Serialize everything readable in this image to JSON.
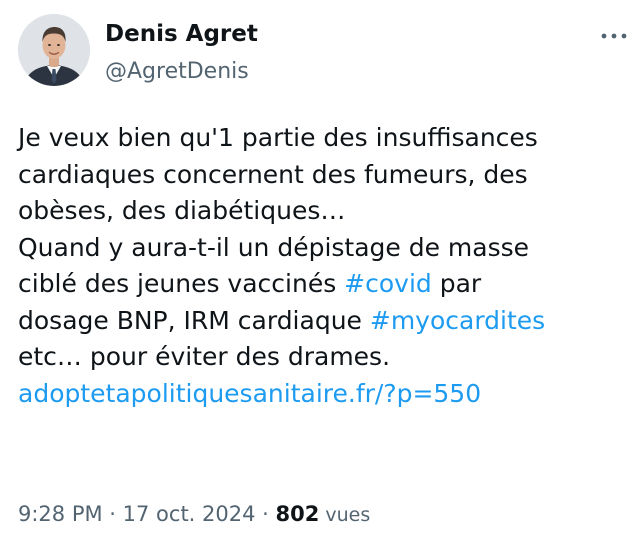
{
  "author": {
    "name": "Denis Agret",
    "handle": "@AgretDenis",
    "avatar_icon": "profile-photo-man-in-suit"
  },
  "menu": {
    "icon": "more-horizontal-icon",
    "glyph": "···"
  },
  "tweet": {
    "line_1": "Je veux bien qu'1 partie des insuffisances",
    "line_2": "cardiaques concernent des fumeurs, des",
    "line_3": "obèses, des diabétiques…",
    "line_4": "Quand y aura-t-il un dépistage de masse",
    "line_5_before": "ciblé des jeunes vaccinés ",
    "hashtag_covid": "#covid",
    "line_5_after": " par",
    "line_6_before": "dosage BNP, IRM cardiaque ",
    "hashtag_myocardites": "#myocardites",
    "line_7": "etc… pour éviter des drames.",
    "link": "adoptetapolitiquesanitaire.fr/?p=550"
  },
  "meta": {
    "time": "9:28 PM",
    "separator_1": " · ",
    "date": "17 oct. 2024",
    "separator_2": " · ",
    "views_count": "802",
    "views_label": " vues"
  },
  "colors": {
    "text": "#0f1419",
    "secondary": "#536471",
    "link": "#1d9bf0",
    "background": "#ffffff"
  }
}
